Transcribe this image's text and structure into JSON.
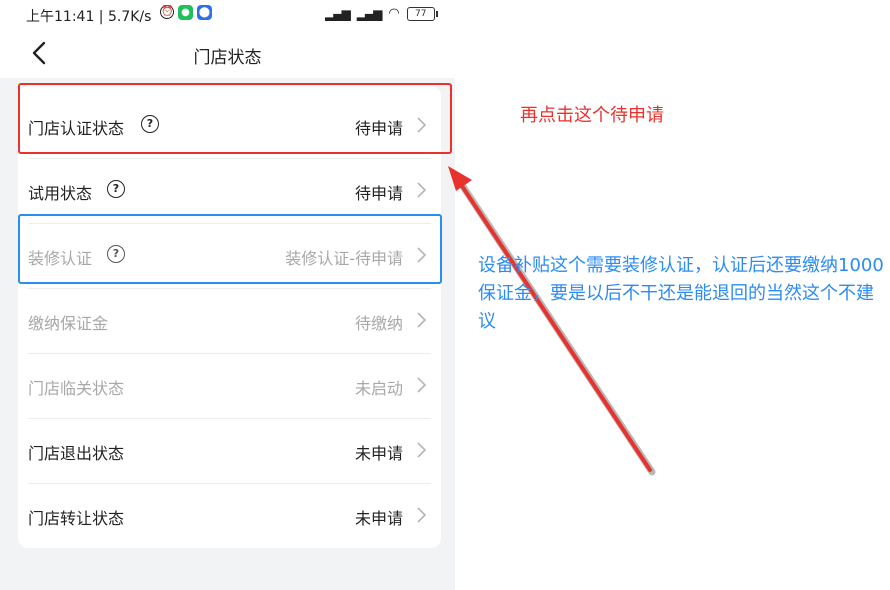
{
  "statusbar": {
    "time_speed": "上午11:41 | 5.7K/s",
    "battery": "77"
  },
  "navbar": {
    "title": "门店状态"
  },
  "rows": [
    {
      "label": "门店认证状态",
      "value": "待申请",
      "help": "?"
    },
    {
      "label": "试用状态",
      "value": "待申请",
      "help": "?"
    },
    {
      "label": "装修认证",
      "value": "装修认证-待申请",
      "help": "?"
    },
    {
      "label": "缴纳保证金",
      "value": "待缴纳"
    },
    {
      "label": "门店临关状态",
      "value": "未启动"
    },
    {
      "label": "门店退出状态",
      "value": "未申请"
    },
    {
      "label": "门店转让状态",
      "value": "未申请"
    }
  ],
  "annotations": {
    "red_note": "再点击这个待申请",
    "blue_note": "设备补贴这个需要装修认证，认证后还要缴纳1000保证金，要是以后不干还是能退回的当然这个不建议",
    "red_color": "#e8322e",
    "blue_color": "#2d8cf0"
  }
}
